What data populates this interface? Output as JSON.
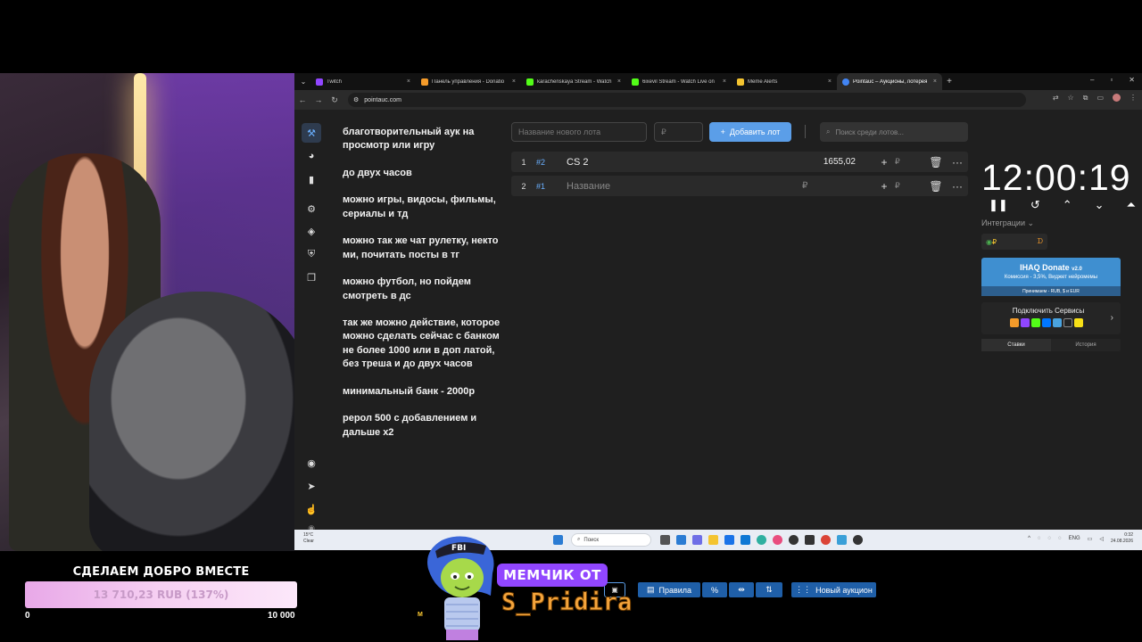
{
  "browser": {
    "tabs": [
      {
        "label": "Twitch",
        "color": "#9146ff"
      },
      {
        "label": "Панель управления - Donatio",
        "color": "#f49b2a"
      },
      {
        "label": "karachenskaya Stream - Watch",
        "color": "#53fc18"
      },
      {
        "label": "6ixevil Stream - Watch Live on",
        "color": "#53fc18"
      },
      {
        "label": "Meme Alerts",
        "color": "#f4c430"
      },
      {
        "label": "Pointauc – Аукционы, лотерея",
        "color": "#4285f4"
      }
    ],
    "url": "pointauc.com"
  },
  "rules_lines": [
    "благотворительный аук на просмотр или игру",
    "до  двух часов",
    "можно игры, видосы, фильмы, сериалы и тд",
    "можно так же чат рулетку, некто ми, почитать посты в тг",
    "можно футбол, но пойдем смотреть в дс",
    "так же можно действие, которое можно сделать сейчас с банком не более 1000 или в доп латой, без треша  и до двух часов",
    "минимальный банк - 2000р",
    "рерол 500 с добавлением и дальше х2"
  ],
  "lot_form": {
    "name_placeholder": "Название нового лота",
    "price_placeholder": "₽",
    "add_label": "Добавить лот",
    "search_placeholder": "Поиск среди лотов..."
  },
  "lots": [
    {
      "num": "1",
      "id": "#2",
      "name": "CS 2",
      "amount": "1655,02",
      "rub": "₽"
    },
    {
      "num": "2",
      "id": "#1",
      "name": "Название",
      "amount": "₽",
      "rub": "₽"
    }
  ],
  "bottom_bar": {
    "rules_label": "Правила",
    "percent_label": "%",
    "new_auction_label": "Новый аукцион"
  },
  "timer": {
    "value": "12:00:19"
  },
  "integrations": {
    "label": "Интеграции",
    "rub": "₽",
    "donate_title": "IHAQ Donate",
    "donate_version": "v2.0",
    "donate_subtitle": "Комиссия - 3,5%, Виджет нейромемы",
    "donate_payments": "Принимаем - RUB, $ и EUR",
    "connect_label": "Подключить Сервисы",
    "tab_bids": "Ставки",
    "tab_history": "История"
  },
  "taskbar": {
    "weather_temp": "15°C",
    "weather_text": "Clear",
    "search": "Поиск",
    "lang": "ENG",
    "time": "0:32",
    "date": "24.08.2026"
  },
  "goal": {
    "title": "СДЕЛАЕМ ДОБРО ВМЕСТЕ",
    "progress_text": "13 710,23 RUB (137%)",
    "min": "0",
    "max": "10 000",
    "progress_percent": 137
  },
  "meme": {
    "badge": "МЕМЧИК ОТ",
    "name": "S_Pridira",
    "cap_text": "FBI",
    "small_mark": "M"
  },
  "colors": {
    "accent": "#5b9ee8",
    "twitch": "#9146ff"
  }
}
